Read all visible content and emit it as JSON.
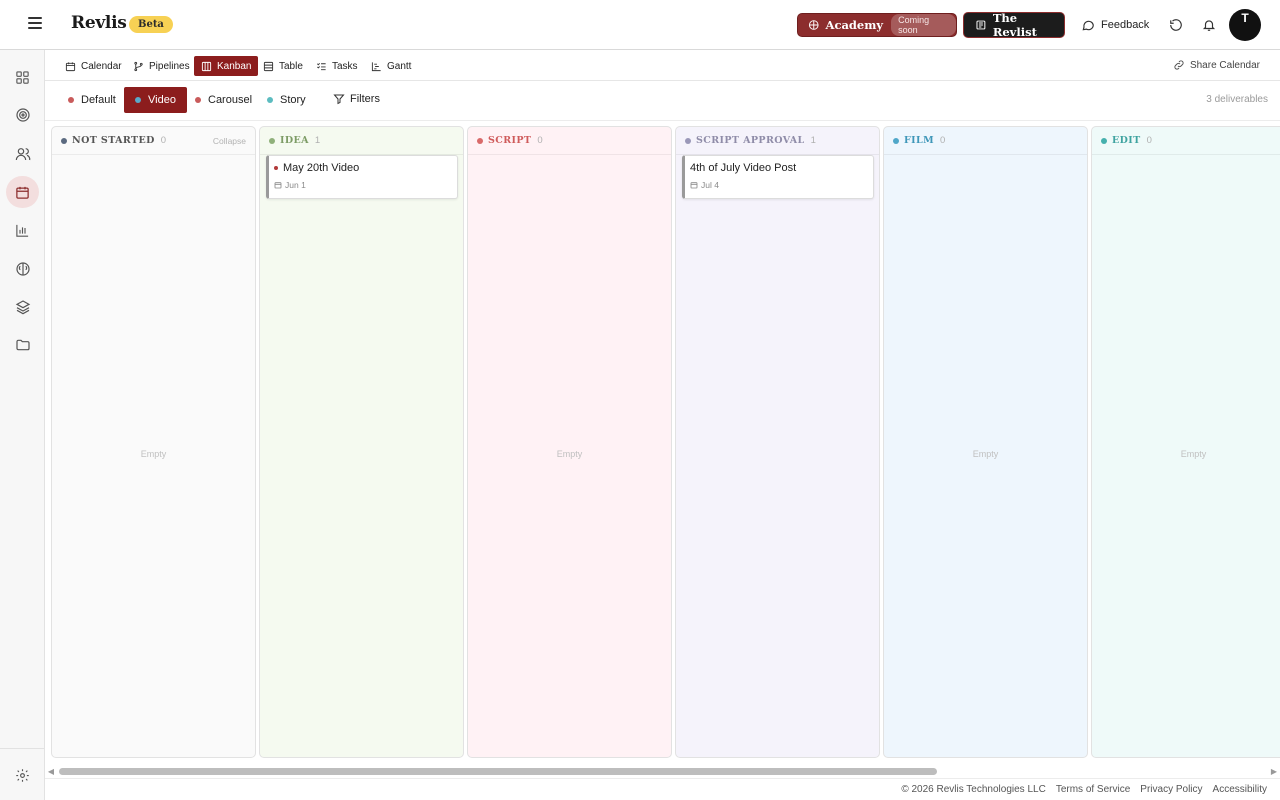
{
  "header": {
    "brand": "Revlis",
    "beta_badge": "Beta",
    "academy_label": "Academy",
    "academy_badge": "Coming soon",
    "revlist_label": "The Revlist",
    "feedback_label": "Feedback",
    "avatar_initial": "T",
    "accent_color": "#8c2d2d"
  },
  "sidebar": {
    "items": [
      {
        "icon": "dashboard-icon"
      },
      {
        "icon": "target-icon"
      },
      {
        "icon": "users-icon"
      },
      {
        "icon": "calendar-icon",
        "active": true
      },
      {
        "icon": "analytics-icon"
      },
      {
        "icon": "brain-icon"
      },
      {
        "icon": "layers-icon"
      },
      {
        "icon": "folder-icon"
      }
    ],
    "settings_icon": "settings-icon"
  },
  "views": {
    "tabs": [
      {
        "label": "Calendar",
        "icon": "calendar-icon"
      },
      {
        "label": "Pipelines",
        "icon": "branch-icon"
      },
      {
        "label": "Kanban",
        "icon": "kanban-icon",
        "active": true
      },
      {
        "label": "Table",
        "icon": "table-icon"
      },
      {
        "label": "Tasks",
        "icon": "tasks-icon"
      },
      {
        "label": "Gantt",
        "icon": "gantt-icon"
      }
    ],
    "share_label": "Share Calendar"
  },
  "filters": {
    "types": [
      {
        "label": "Default",
        "color": "#c95b5b"
      },
      {
        "label": "Video",
        "color": "#5aa9c9",
        "active": true
      },
      {
        "label": "Carousel",
        "color": "#c95b5b"
      },
      {
        "label": "Story",
        "color": "#5cbcc0"
      }
    ],
    "filters_label": "Filters",
    "deliverables": "3 deliverables"
  },
  "board": {
    "collapse_label": "Collapse",
    "empty_label": "Empty",
    "columns": [
      {
        "title": "NOT STARTED",
        "count": "0",
        "color": "#5b6a80",
        "bg": "#fafafa",
        "titleColor": "#555555",
        "cards": []
      },
      {
        "title": "IDEA",
        "count": "1",
        "color": "#8fb07a",
        "bg": "#f5faf0",
        "titleColor": "#7d9c66",
        "cards": [
          {
            "title": "May 20th Video",
            "date": "Jun 1"
          }
        ]
      },
      {
        "title": "SCRIPT",
        "count": "0",
        "color": "#d96a6a",
        "bg": "#fff2f5",
        "titleColor": "#cf5b5b",
        "cards": []
      },
      {
        "title": "SCRIPT APPROVAL",
        "count": "1",
        "color": "#9a98b8",
        "bg": "#f5f3fb",
        "titleColor": "#8f8ca8",
        "cards": [
          {
            "title": "4th of July Video Post",
            "date": "Jul 4"
          }
        ]
      },
      {
        "title": "FILM",
        "count": "0",
        "color": "#4fa7c9",
        "bg": "#eef6fd",
        "titleColor": "#3f97b9",
        "cards": []
      },
      {
        "title": "EDIT",
        "count": "0",
        "color": "#45b0ad",
        "bg": "#effaf9",
        "titleColor": "#3fa3a0",
        "cards": []
      }
    ]
  },
  "footer": {
    "copyright": "© 2026 Revlis Technologies LLC",
    "terms": "Terms of Service",
    "privacy": "Privacy Policy",
    "accessibility": "Accessibility"
  }
}
